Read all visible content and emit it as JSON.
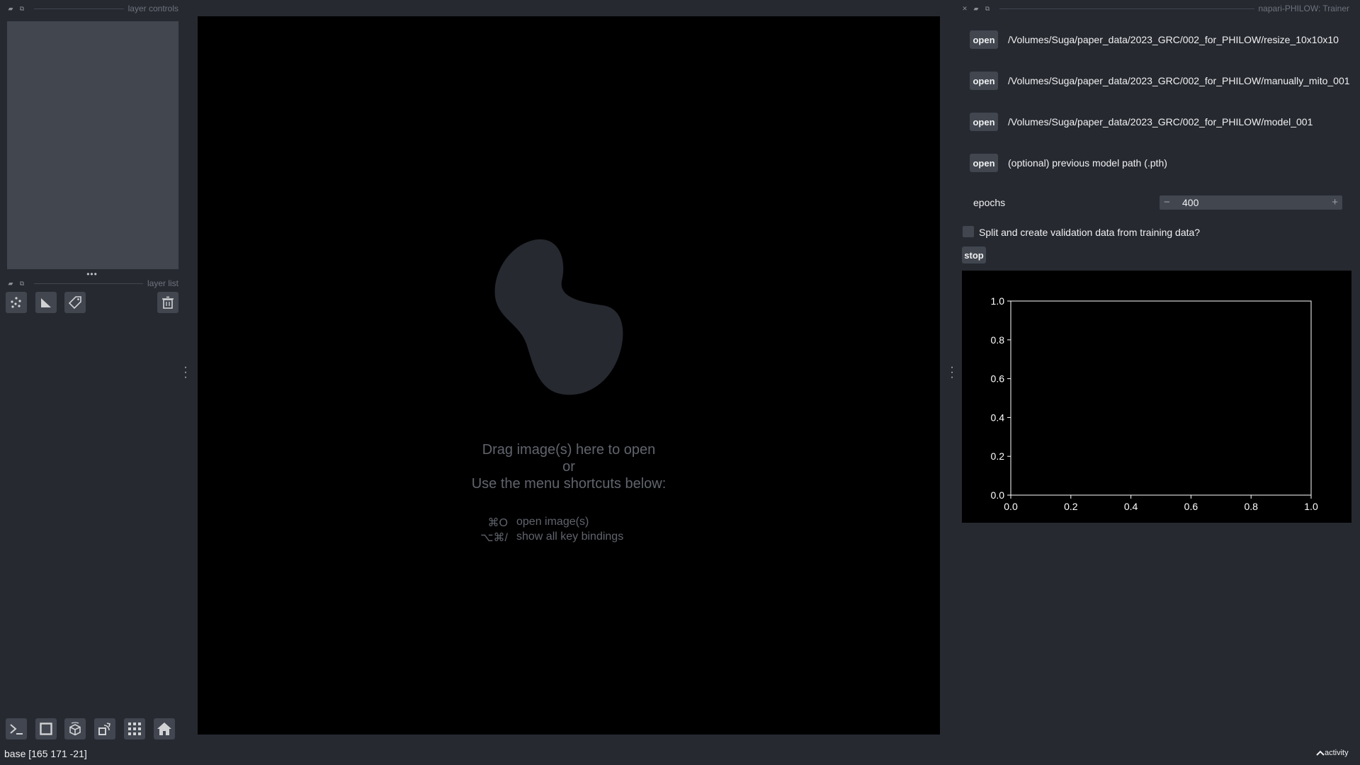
{
  "layer_controls": {
    "title": "layer controls"
  },
  "layer_list": {
    "title": "layer list"
  },
  "layer_buttons": [
    "new-points-layer-icon",
    "new-shapes-layer-icon",
    "new-labels-layer-icon",
    "delete-layer-icon"
  ],
  "viewer_buttons": [
    "console-icon",
    "2d-3d-toggle-icon",
    "roll-dimensions-icon",
    "transpose-icon",
    "grid-icon",
    "home-icon"
  ],
  "canvas": {
    "line1": "Drag image(s) here to open",
    "line2": "or",
    "line3": "Use the menu shortcuts below:",
    "shortcuts": [
      {
        "key": "⌘O",
        "action": "open image(s)"
      },
      {
        "key": "⌥⌘/",
        "action": "show all key bindings"
      }
    ]
  },
  "trainer": {
    "title": "napari-PHILOW: Trainer",
    "open_label": "open",
    "paths": [
      "/Volumes/Suga/paper_data/2023_GRC/002_for_PHILOW/resize_10x10x10",
      "/Volumes/Suga/paper_data/2023_GRC/002_for_PHILOW/manually_mito_001",
      "/Volumes/Suga/paper_data/2023_GRC/002_for_PHILOW/model_001",
      "(optional) previous model path (.pth)"
    ],
    "epochs_label": "epochs",
    "epochs_value": "400",
    "minus": "−",
    "plus": "+",
    "checkbox_label": "Split and create validation data from training data?",
    "checkbox_checked": false,
    "stop_label": "stop"
  },
  "chart_data": {
    "type": "line",
    "title": "",
    "xlabel": "",
    "ylabel": "",
    "xlim": [
      0.0,
      1.0
    ],
    "ylim": [
      0.0,
      1.0
    ],
    "x_ticks": [
      "0.0",
      "0.2",
      "0.4",
      "0.6",
      "0.8",
      "1.0"
    ],
    "y_ticks": [
      "0.0",
      "0.2",
      "0.4",
      "0.6",
      "0.8",
      "1.0"
    ],
    "series": [],
    "background": "#000000",
    "axis_color": "#ffffff"
  },
  "status_bar": {
    "text": "base [165 171 -21]",
    "activity": "activity"
  },
  "colors": {
    "background": "#262930",
    "panel": "#41464f",
    "canvas": "#000000",
    "text": "#f0f1f2",
    "muted": "#60646c"
  }
}
